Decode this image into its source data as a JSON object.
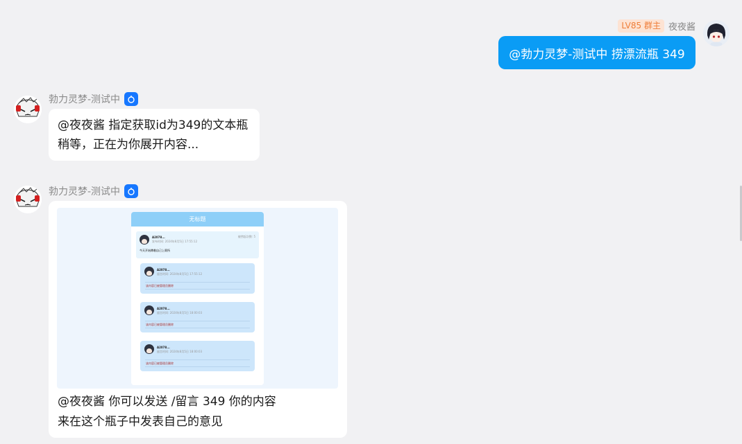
{
  "outgoing": {
    "badge": "LV85 群主",
    "sender": "夜夜酱",
    "text": "@勃力灵梦-测试中 捞漂流瓶 349"
  },
  "bot": {
    "name": "勃力灵梦-测试中",
    "badge_icon": "bot-icon"
  },
  "msg1": {
    "line1": "@夜夜酱 指定获取id为349的文本瓶",
    "line2": "稍等，正在为你展开内容..."
  },
  "card": {
    "title": "无标题",
    "post": {
      "user": "A2078...",
      "time": "发布时间: 2024年8月5日 17:55:12",
      "corner": "被捞起次数: 5",
      "content": "今天开始蹲着自己上厕所"
    },
    "replies": [
      {
        "user": "A2078...",
        "time": "留言时间: 2024年8月5日 17:55:12",
        "content": "该内容已被管理员删除"
      },
      {
        "user": "A2078...",
        "time": "留言时间: 2024年8月5日 18:00:03",
        "content": "该内容已被管理员删除"
      },
      {
        "user": "A2078...",
        "time": "留言时间: 2024年8月5日 18:00:03",
        "content": "该内容已被管理员删除"
      }
    ]
  },
  "msg2": {
    "line1": "@夜夜酱 你可以发送 /留言 349 你的内容",
    "line2": "来在这个瓶子中发表自己的意见"
  },
  "colors": {
    "outgoing_bubble": "#0a9cf5",
    "badge_bg": "#fde3d3",
    "badge_text": "#ef7d38",
    "bot_badge": "#1677ff"
  }
}
